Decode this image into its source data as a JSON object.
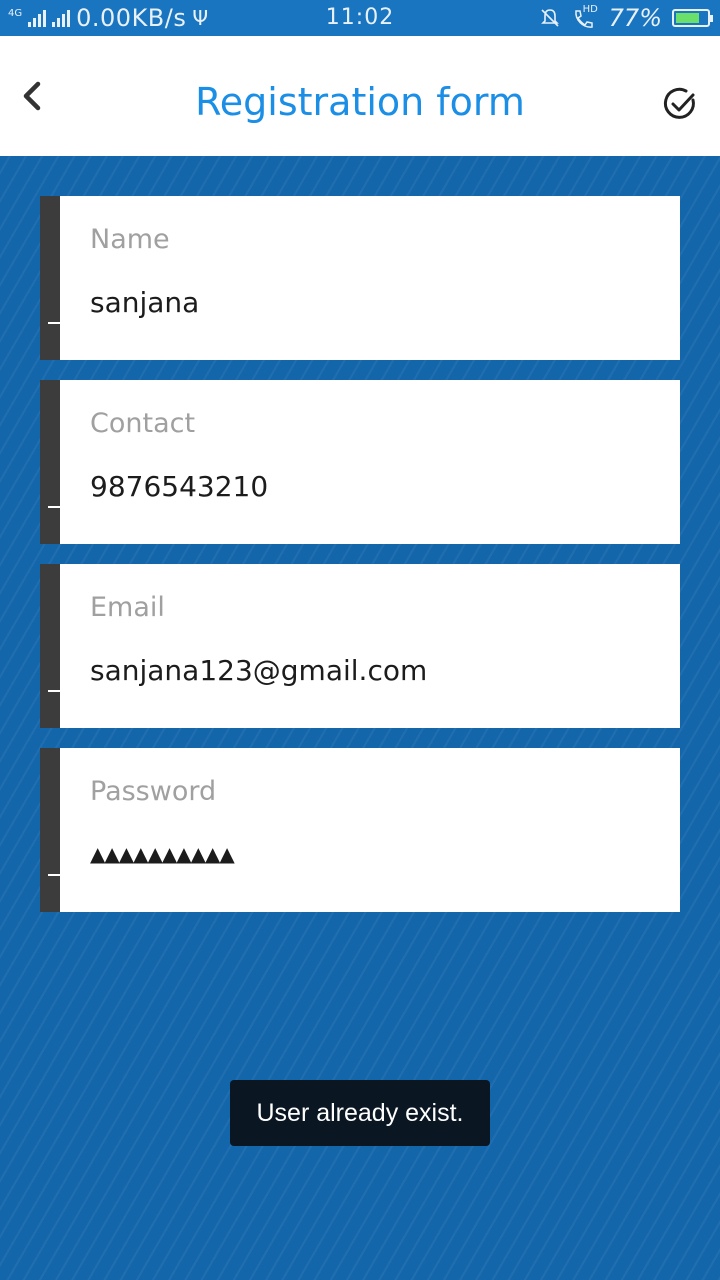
{
  "status_bar": {
    "network_type": "4G",
    "speed": "0.00KB/s",
    "time": "11:02",
    "hd_label": "HD",
    "battery_percent": "77%",
    "battery_level": 0.77,
    "battery_color": "#6ae06a"
  },
  "header": {
    "title": "Registration form",
    "back_icon": "chevron-left-icon",
    "confirm_icon": "check-circle-icon",
    "title_color": "#1b8ee6"
  },
  "form": {
    "fields": [
      {
        "label": "Name",
        "value": "sanjana"
      },
      {
        "label": "Contact",
        "value": "9876543210"
      },
      {
        "label": "Email",
        "value": "sanjana123@gmail.com"
      },
      {
        "label": "Password",
        "value": "▲▲▲▲▲▲▲▲▲▲"
      }
    ]
  },
  "toast": {
    "message": "User already exist."
  },
  "colors": {
    "background": "#1466ab",
    "status_bar": "#1a75c0",
    "field_bar": "#3c3c3c"
  }
}
